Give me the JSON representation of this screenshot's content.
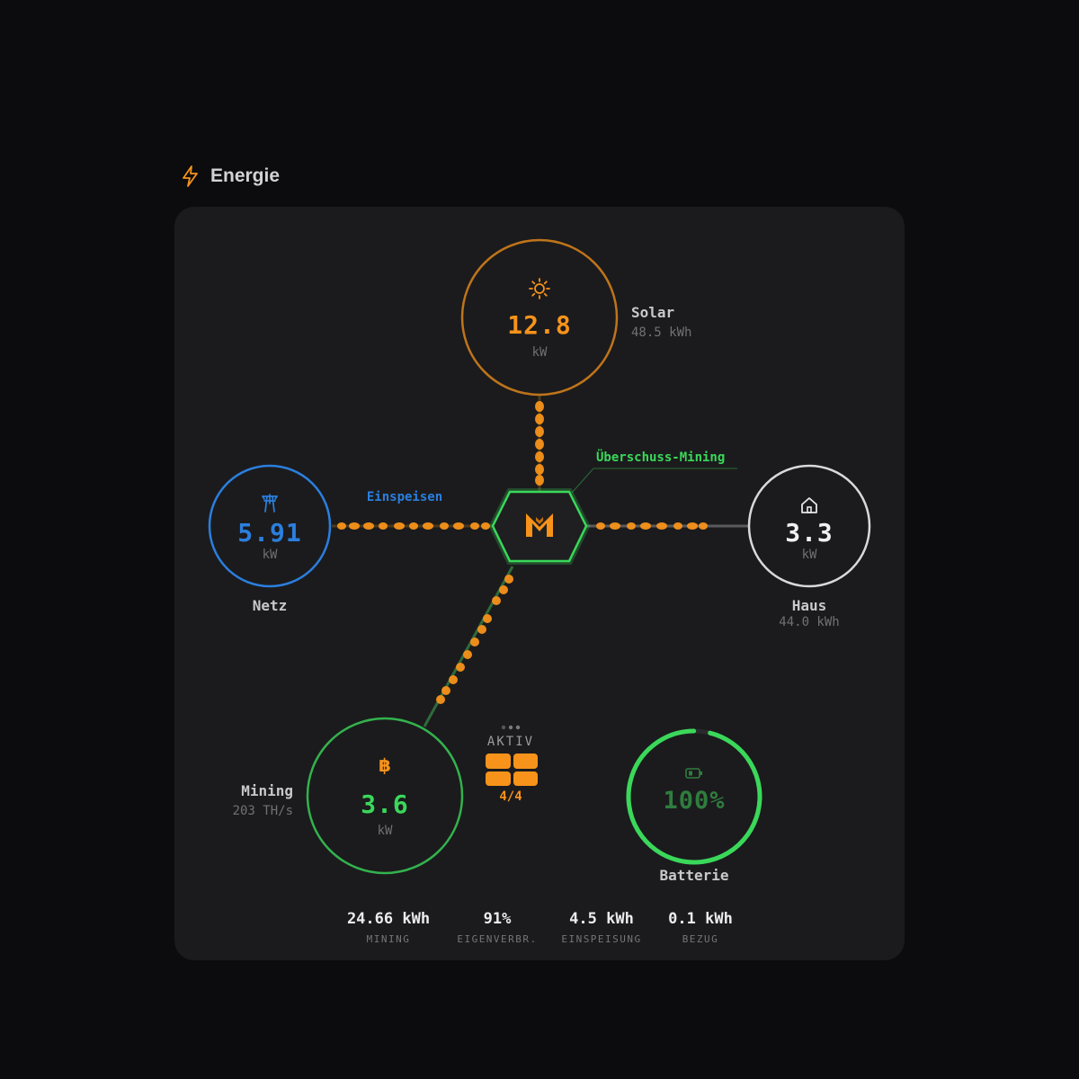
{
  "header": {
    "title": "Energie",
    "icon": "lightning-icon"
  },
  "colors": {
    "solar": "#f7931a",
    "grid": "#2b7fde",
    "house": "#d9d9db",
    "mining": "#3ad85a",
    "hub": "#3ad85a",
    "battery": "#3ad85a",
    "flow": "#f7931a"
  },
  "solar": {
    "icon": "sun-icon",
    "value": "12.8",
    "unit": "kW",
    "name": "Solar",
    "energy": "48.5 kWh"
  },
  "grid": {
    "icon": "power-pylon-icon",
    "value": "5.91",
    "unit": "kW",
    "name": "Netz",
    "flow_label": "Einspeisen"
  },
  "house": {
    "icon": "house-icon",
    "value": "3.3",
    "unit": "kW",
    "name": "Haus",
    "energy": "44.0 kWh"
  },
  "hub": {
    "icon": "logo-m-icon",
    "mode_label": "Überschuss-Mining"
  },
  "mining": {
    "icon": "bitcoin-icon",
    "value": "3.6",
    "unit": "kW",
    "name": "Mining",
    "hashrate": "203 TH/s"
  },
  "miners": {
    "status": "AKTIV",
    "count": "4/4",
    "active": 4,
    "total": 4
  },
  "battery": {
    "icon": "battery-icon",
    "percent": "100%",
    "level": 1.0,
    "name": "Batterie"
  },
  "stats": [
    {
      "value": "24.66 kWh",
      "label": "MINING"
    },
    {
      "value": "91%",
      "label": "EIGENVERBR."
    },
    {
      "value": "4.5 kWh",
      "label": "EINSPEISUNG"
    },
    {
      "value": "0.1 kWh",
      "label": "BEZUG"
    }
  ]
}
